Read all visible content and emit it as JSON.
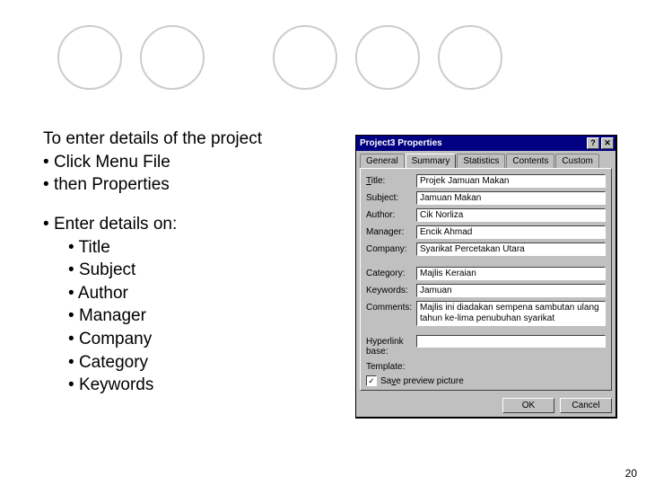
{
  "slide": {
    "intro": "To enter details of the project",
    "step1": "Click Menu File",
    "step2": "then Properties",
    "enter_heading": "Enter details on:",
    "fields": [
      "Title",
      "Subject",
      "Author",
      "Manager",
      "Company",
      "Category",
      "Keywords"
    ],
    "page_number": "20"
  },
  "dialog": {
    "title": "Project3 Properties",
    "help_btn": "?",
    "close_btn": "✕",
    "tabs": [
      "General",
      "Summary",
      "Statistics",
      "Contents",
      "Custom"
    ],
    "active_tab": "Summary",
    "labels": {
      "title": "Title:",
      "subject": "Subject:",
      "author": "Author:",
      "manager": "Manager:",
      "company": "Company:",
      "category": "Category:",
      "keywords": "Keywords:",
      "comments": "Comments:",
      "hyperlink": "Hyperlink base:",
      "template": "Template:"
    },
    "values": {
      "title": "Projek Jamuan Makan",
      "subject": "Jamuan Makan",
      "author": "Cik Norliza",
      "manager": "Encik Ahmad",
      "company": "Syarikat Percetakan Utara",
      "category": "Majlis Keraian",
      "keywords": "Jamuan",
      "comments": "Majlis ini diadakan sempena sambutan ulang tahun ke-lima penubuhan syarikat",
      "hyperlink": "",
      "template": ""
    },
    "save_preview": "Save preview picture",
    "save_preview_checked": "✓",
    "ok": "OK",
    "cancel": "Cancel"
  }
}
